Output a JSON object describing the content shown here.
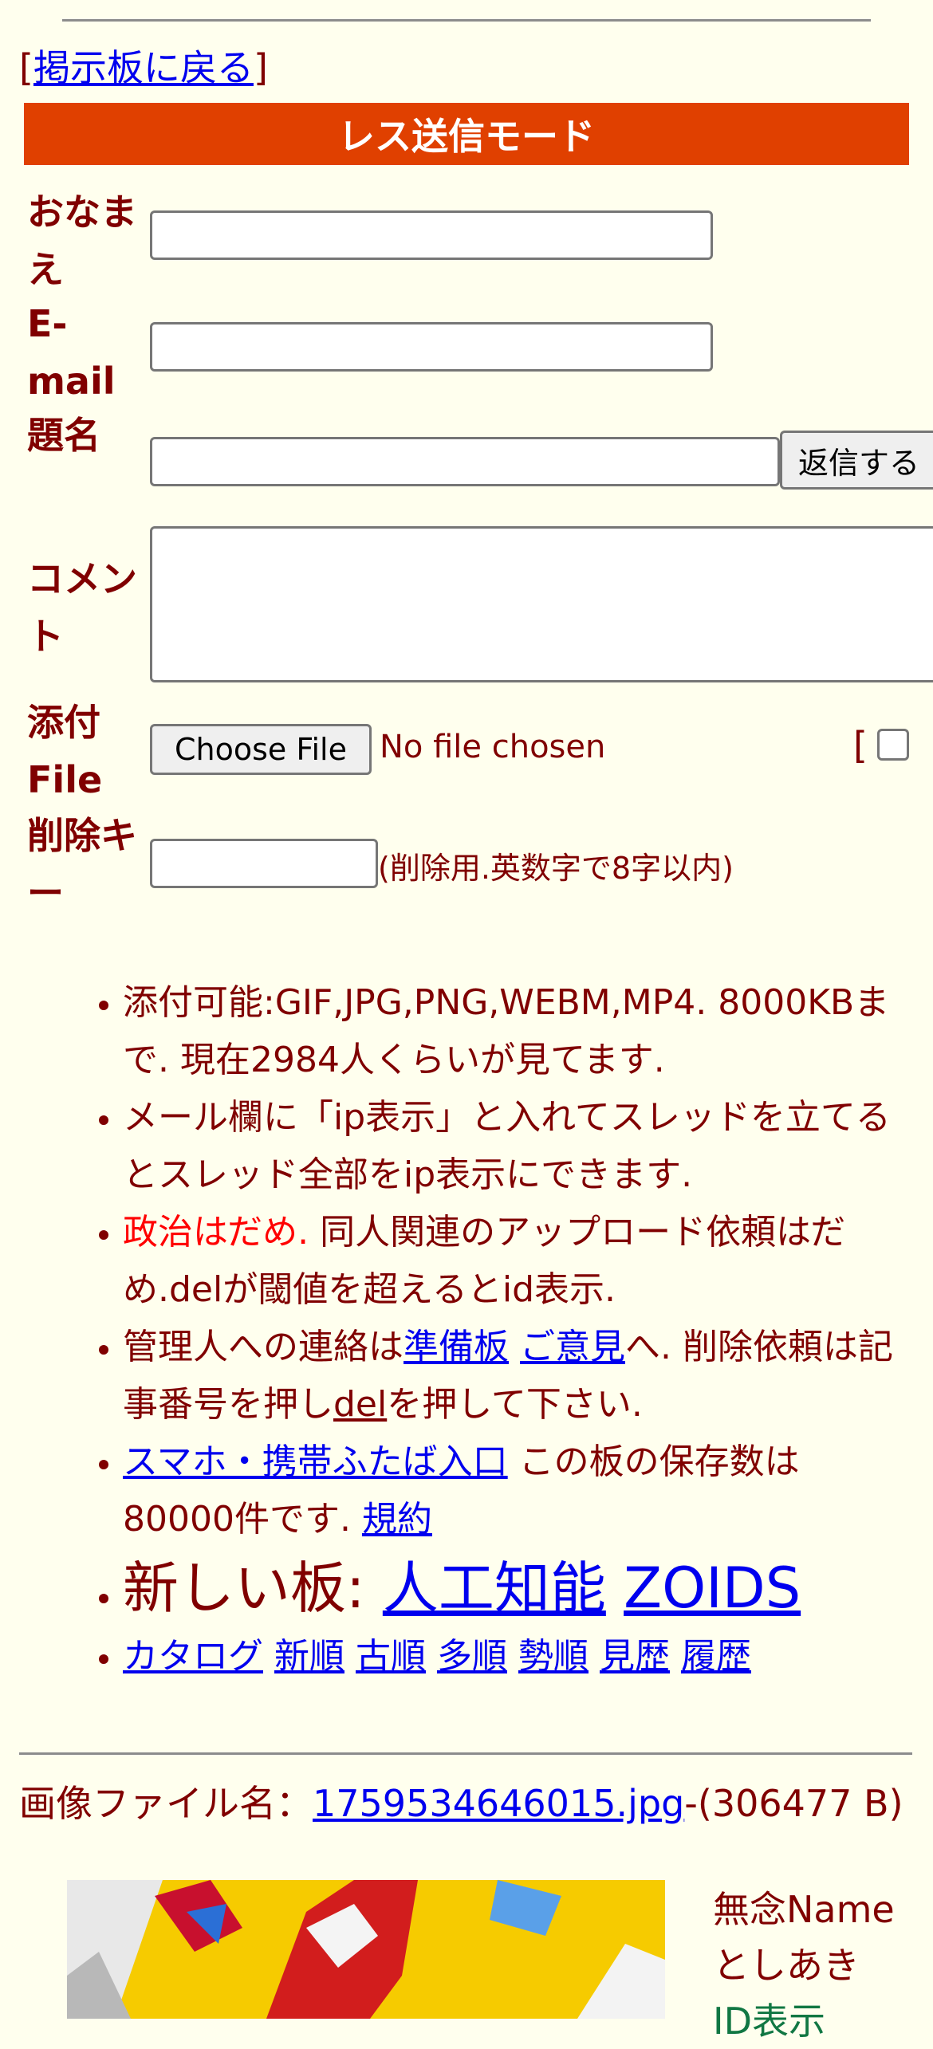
{
  "nav": {
    "open_bracket": "[",
    "back_link": "掲示板に戻る",
    "close_bracket": "]"
  },
  "banner": {
    "title": "レス送信モード"
  },
  "form": {
    "name_label": "おなまえ",
    "email_label": "E-mail",
    "subject_label": "題名",
    "submit_label": "返信する",
    "comment_label": "コメント",
    "file_label": "添付File",
    "choose_file": "Choose File",
    "no_file": "No file chosen",
    "image_bracket": "[",
    "delkey_label": "削除キー",
    "delkey_note": "(削除用.英数字で8字以内)"
  },
  "notes": {
    "n1": "添付可能:GIF,JPG,PNG,WEBM,MP4. 8000KBまで. 現在2984人くらいが見てます.",
    "n2": "メール欄に「ip表示」と入れてスレッドを立てるとスレッド全部をip表示にできます.",
    "n3_red": "政治はだめ.",
    "n3_rest": " 同人関連のアップロード依頼はだめ.delが閾値を超えるとid表示.",
    "n4_a": "管理人への連絡は",
    "n4_link1": "準備板",
    "n4_link2": "ご意見",
    "n4_b": "へ. 削除依頼は記事番号を押し",
    "n4_del": "del",
    "n4_c": "を押して下さい.",
    "n5_link": "スマホ・携帯ふたば入口",
    "n5_text": " この板の保存数は80000件です. ",
    "n5_rules": "規約",
    "n6_text": "新しい板: ",
    "n6_link1": "人工知能",
    "n6_link2": "ZOIDS",
    "n7_links": [
      "カタログ",
      "新順",
      "古順",
      "多順",
      "勢順",
      "見歴",
      "履歴"
    ]
  },
  "post": {
    "file_prefix": "画像ファイル名：",
    "file_link": "1759534646015.jpg",
    "file_size": "-(306477 B)",
    "name": "無念Name",
    "author": "としあき",
    "id_text": "ID表示"
  }
}
